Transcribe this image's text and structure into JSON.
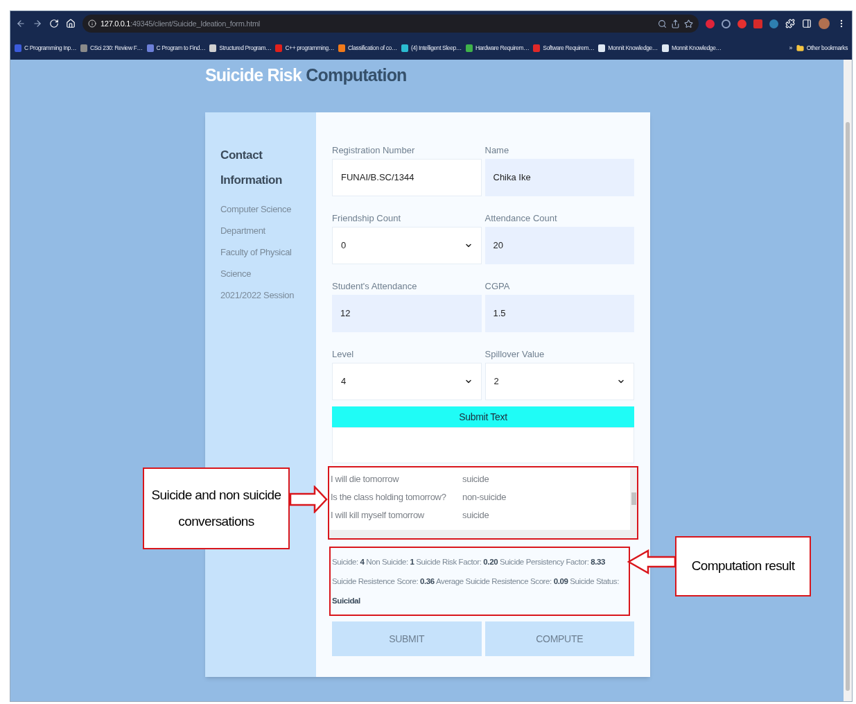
{
  "browser": {
    "url": {
      "host": "127.0.0.1",
      "path": ":49345/client/Suicide_Ideation_form.html"
    },
    "bookmarks": [
      {
        "label": "C Programming Inp…",
        "color": "#3b5bdb"
      },
      {
        "label": "CSci 230: Review F…",
        "color": "#8a8a8a"
      },
      {
        "label": "C Program to Find…",
        "color": "#6c7fd8"
      },
      {
        "label": "Structured Program…",
        "color": "#d0d0d0"
      },
      {
        "label": "C++ programming…",
        "color": "#e0201b"
      },
      {
        "label": "Classification of co…",
        "color": "#f07a1a"
      },
      {
        "label": "(4) Intelligent Sleep…",
        "color": "#2bbbd0"
      },
      {
        "label": "Hardware Requirem…",
        "color": "#3fb24a"
      },
      {
        "label": "Software Requirem…",
        "color": "#e02828"
      },
      {
        "label": "Monnit Knowledge…",
        "color": "#dfe8f2"
      },
      {
        "label": "Monnit Knowledge…",
        "color": "#dfe8f2"
      }
    ],
    "more": "»",
    "other_bookmarks": "Other bookmarks"
  },
  "page": {
    "title": {
      "first": "Suicide Risk",
      "second": "Computation"
    },
    "sidebar": {
      "heading": [
        "Contact",
        "Information"
      ],
      "lines": [
        "Computer Science",
        "Department",
        "Faculty of Physical",
        "Science",
        "2021/2022 Session"
      ]
    },
    "fields": [
      {
        "label": "Registration Number",
        "value": "FUNAI/B.SC/1344",
        "kind": "input",
        "autofilled": false
      },
      {
        "label": "Name",
        "value": "Chika Ike",
        "kind": "input",
        "autofilled": true
      },
      {
        "label": "Friendship Count",
        "value": "0",
        "kind": "select",
        "autofilled": false
      },
      {
        "label": "Attendance Count",
        "value": "20",
        "kind": "input",
        "autofilled": true
      },
      {
        "label": "Student's Attendance",
        "value": "12",
        "kind": "input",
        "autofilled": true
      },
      {
        "label": "CGPA",
        "value": "1.5",
        "kind": "input",
        "autofilled": true
      },
      {
        "label": "Level",
        "value": "4",
        "kind": "select",
        "autofilled": false
      },
      {
        "label": "Spillover Value",
        "value": "2",
        "kind": "select",
        "autofilled": false
      }
    ],
    "submit_text_button": "Submit Text",
    "conversations": [
      {
        "text": "I will die tomorrow",
        "label": "suicide"
      },
      {
        "text": "Is the class holding tomorrow?",
        "label": "non-suicide"
      },
      {
        "text": "I will kill myself tomorrow",
        "label": "suicide"
      }
    ],
    "result": "Suicide: **4** Non Suicide: **1** Suicide Risk Factor: **0.20** Suicide Persistency Factor: **8.33** Suicide Resistence Score: **0.36** Average Suicide Resistence Score: **0.09** Suicide Status: **Suicidal**",
    "buttons": [
      "SUBMIT",
      "COMPUTE"
    ]
  },
  "annotations": [
    {
      "text": "Suicide and non suicide conversations"
    },
    {
      "text": "Computation result"
    }
  ]
}
